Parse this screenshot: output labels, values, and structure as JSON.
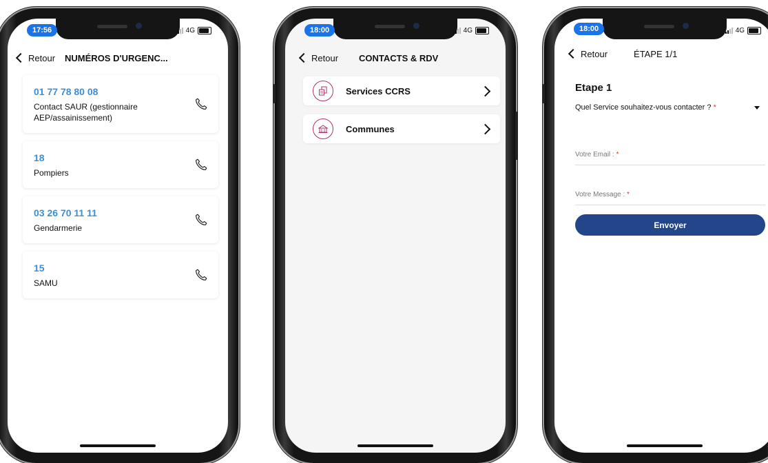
{
  "screens": [
    {
      "status": {
        "time": "17:56",
        "network": "4G"
      },
      "nav": {
        "back_label": "Retour",
        "title": "NUMÉROS D'URGENC..."
      },
      "contacts": [
        {
          "number": "01 77 78 80 08",
          "label": "Contact SAUR (gestionnaire AEP/assainissement)"
        },
        {
          "number": "18",
          "label": "Pompiers"
        },
        {
          "number": "03 26 70 11 11",
          "label": "Gendarmerie"
        },
        {
          "number": "15",
          "label": "SAMU"
        }
      ]
    },
    {
      "status": {
        "time": "18:00",
        "network": "4G"
      },
      "nav": {
        "back_label": "Retour",
        "title": "CONTACTS & RDV"
      },
      "items": [
        {
          "label": "Services CCRS",
          "icon": "documents-icon"
        },
        {
          "label": "Communes",
          "icon": "town-hall-icon"
        }
      ]
    },
    {
      "status": {
        "time": "18:00",
        "network": "4G"
      },
      "nav": {
        "back_label": "Retour",
        "title": "ÉTAPE 1/1"
      },
      "form": {
        "step_title": "Etape 1",
        "service_question": "Quel Service souhaitez-vous contacter ?",
        "required_mark": "*",
        "email_label": "Votre Email :",
        "message_label": "Votre Message :",
        "submit_label": "Envoyer"
      }
    }
  ],
  "colors": {
    "accent_blue": "#3a8fd6",
    "status_pill": "#1a73e8",
    "button_navy": "#23458a",
    "icon_magenta": "#b0306a"
  }
}
